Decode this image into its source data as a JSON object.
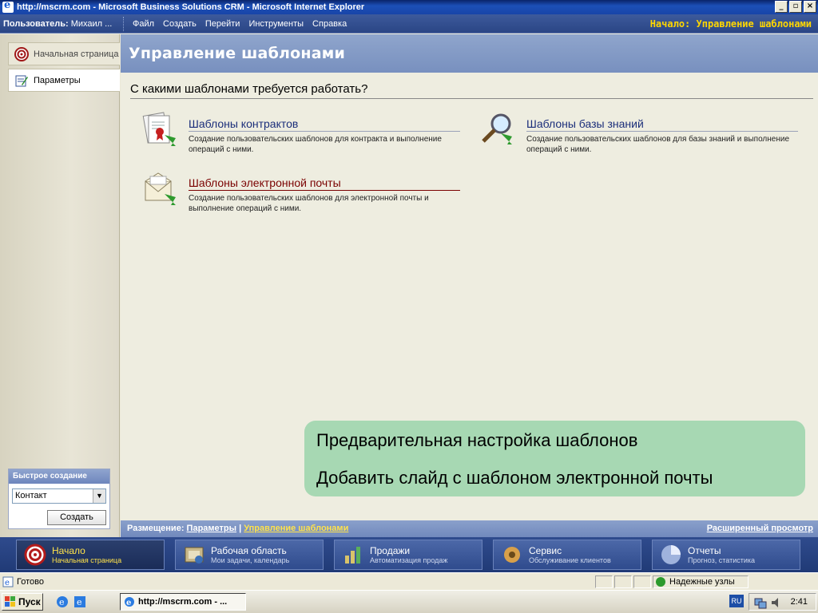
{
  "window": {
    "title": "http://mscrm.com - Microsoft Business Solutions CRM - Microsoft Internet Explorer",
    "min": "_",
    "restore": "▫",
    "close": "×"
  },
  "crm_bar": {
    "user_label": "Пользователь:",
    "user_name": " Михаил ...",
    "menu": [
      "Файл",
      "Создать",
      "Перейти",
      "Инструменты",
      "Справка"
    ],
    "breadcrumb": "Начало: Управление шаблонами"
  },
  "sidebar": {
    "items": [
      {
        "label": "Начальная страница",
        "icon": "home-target-icon"
      },
      {
        "label": "Параметры",
        "icon": "settings-icon"
      }
    ],
    "quick_create": {
      "title": "Быстрое создание",
      "selected": "Контакт",
      "button": "Создать"
    }
  },
  "main": {
    "header": "Управление шаблонами",
    "question": "С какими шаблонами требуется работать?",
    "templates": [
      {
        "title": "Шаблоны контрактов",
        "desc": "Создание пользовательских шаблонов для контракта и выполнение операций с ними.",
        "icon": "contract-template-icon"
      },
      {
        "title": "Шаблоны базы знаний",
        "desc": "Создание пользовательских шаблонов для базы знаний и выполнение операций с ними.",
        "icon": "kb-search-icon"
      },
      {
        "title": "Шаблоны электронной почты",
        "desc": "Создание пользовательских шаблонов для электронной почты и выполнение операций с ними.",
        "icon": "email-template-icon"
      }
    ]
  },
  "callout": {
    "line1": "Предварительная настройка шаблонов",
    "line2": "Добавить слайд с шаблоном электронной почты"
  },
  "placement": {
    "label": "Размещение:",
    "link1": "Параметры",
    "sep": "|",
    "link2": "Управление шаблонами",
    "advanced": "Расширенный просмотр"
  },
  "tabs": [
    {
      "name": "Начало",
      "sub": "Начальная страница",
      "icon": "home-target-icon"
    },
    {
      "name": "Рабочая область",
      "sub": "Мои задачи, календарь",
      "icon": "workplace-icon"
    },
    {
      "name": "Продажи",
      "sub": "Автоматизация продаж",
      "icon": "sales-icon"
    },
    {
      "name": "Сервис",
      "sub": "Обслуживание клиентов",
      "icon": "service-icon"
    },
    {
      "name": "Отчеты",
      "sub": "Прогноз, статистика",
      "icon": "reports-pie-icon"
    }
  ],
  "statusbar": {
    "status": "Готово",
    "zone": "Надежные узлы"
  },
  "taskbar": {
    "start": "Пуск",
    "task": "http://mscrm.com - ...",
    "lang": "RU",
    "clock": "2:41"
  },
  "colors": {
    "accent": "#2a4585",
    "header": "#7890bf",
    "callout": "#a7d8b3",
    "active_text": "#ffe24a"
  }
}
